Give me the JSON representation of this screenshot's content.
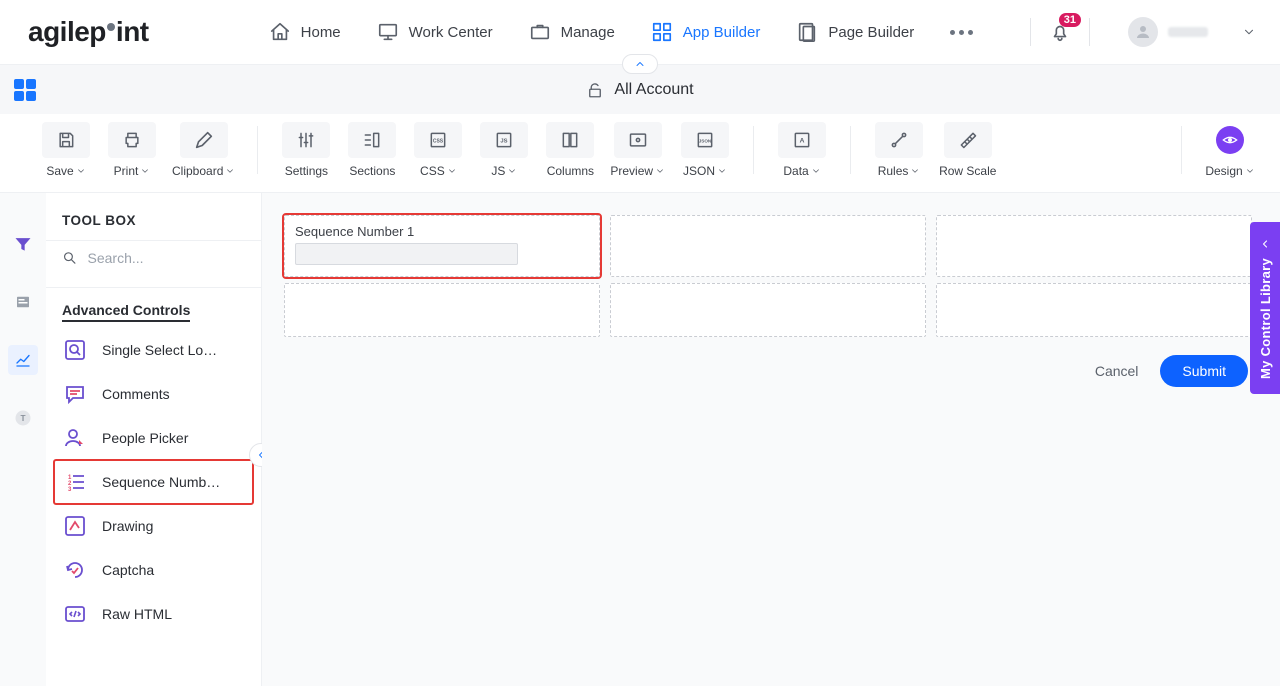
{
  "nav": {
    "logo_prefix": "agilep",
    "logo_suffix": "int",
    "items": [
      {
        "label": "Home"
      },
      {
        "label": "Work Center"
      },
      {
        "label": "Manage"
      },
      {
        "label": "App Builder"
      },
      {
        "label": "Page Builder"
      }
    ],
    "notification_count": "31"
  },
  "subbar": {
    "title": "All Account"
  },
  "toolbar": {
    "save": "Save",
    "print": "Print",
    "clipboard": "Clipboard",
    "settings": "Settings",
    "sections": "Sections",
    "css": "CSS",
    "js": "JS",
    "columns": "Columns",
    "preview": "Preview",
    "json": "JSON",
    "data": "Data",
    "rules": "Rules",
    "rowscale": "Row Scale",
    "design": "Design"
  },
  "toolbox": {
    "title": "TOOL BOX",
    "search_placeholder": "Search...",
    "section": "Advanced Controls",
    "controls": [
      {
        "label": "Single Select Lo…"
      },
      {
        "label": "Comments"
      },
      {
        "label": "People Picker"
      },
      {
        "label": "Sequence Numb…"
      },
      {
        "label": "Drawing"
      },
      {
        "label": "Captcha"
      },
      {
        "label": "Raw HTML"
      }
    ]
  },
  "canvas": {
    "field_label": "Sequence Number 1",
    "cancel": "Cancel",
    "submit": "Submit"
  },
  "sidetab": {
    "label": "My Control Library"
  }
}
